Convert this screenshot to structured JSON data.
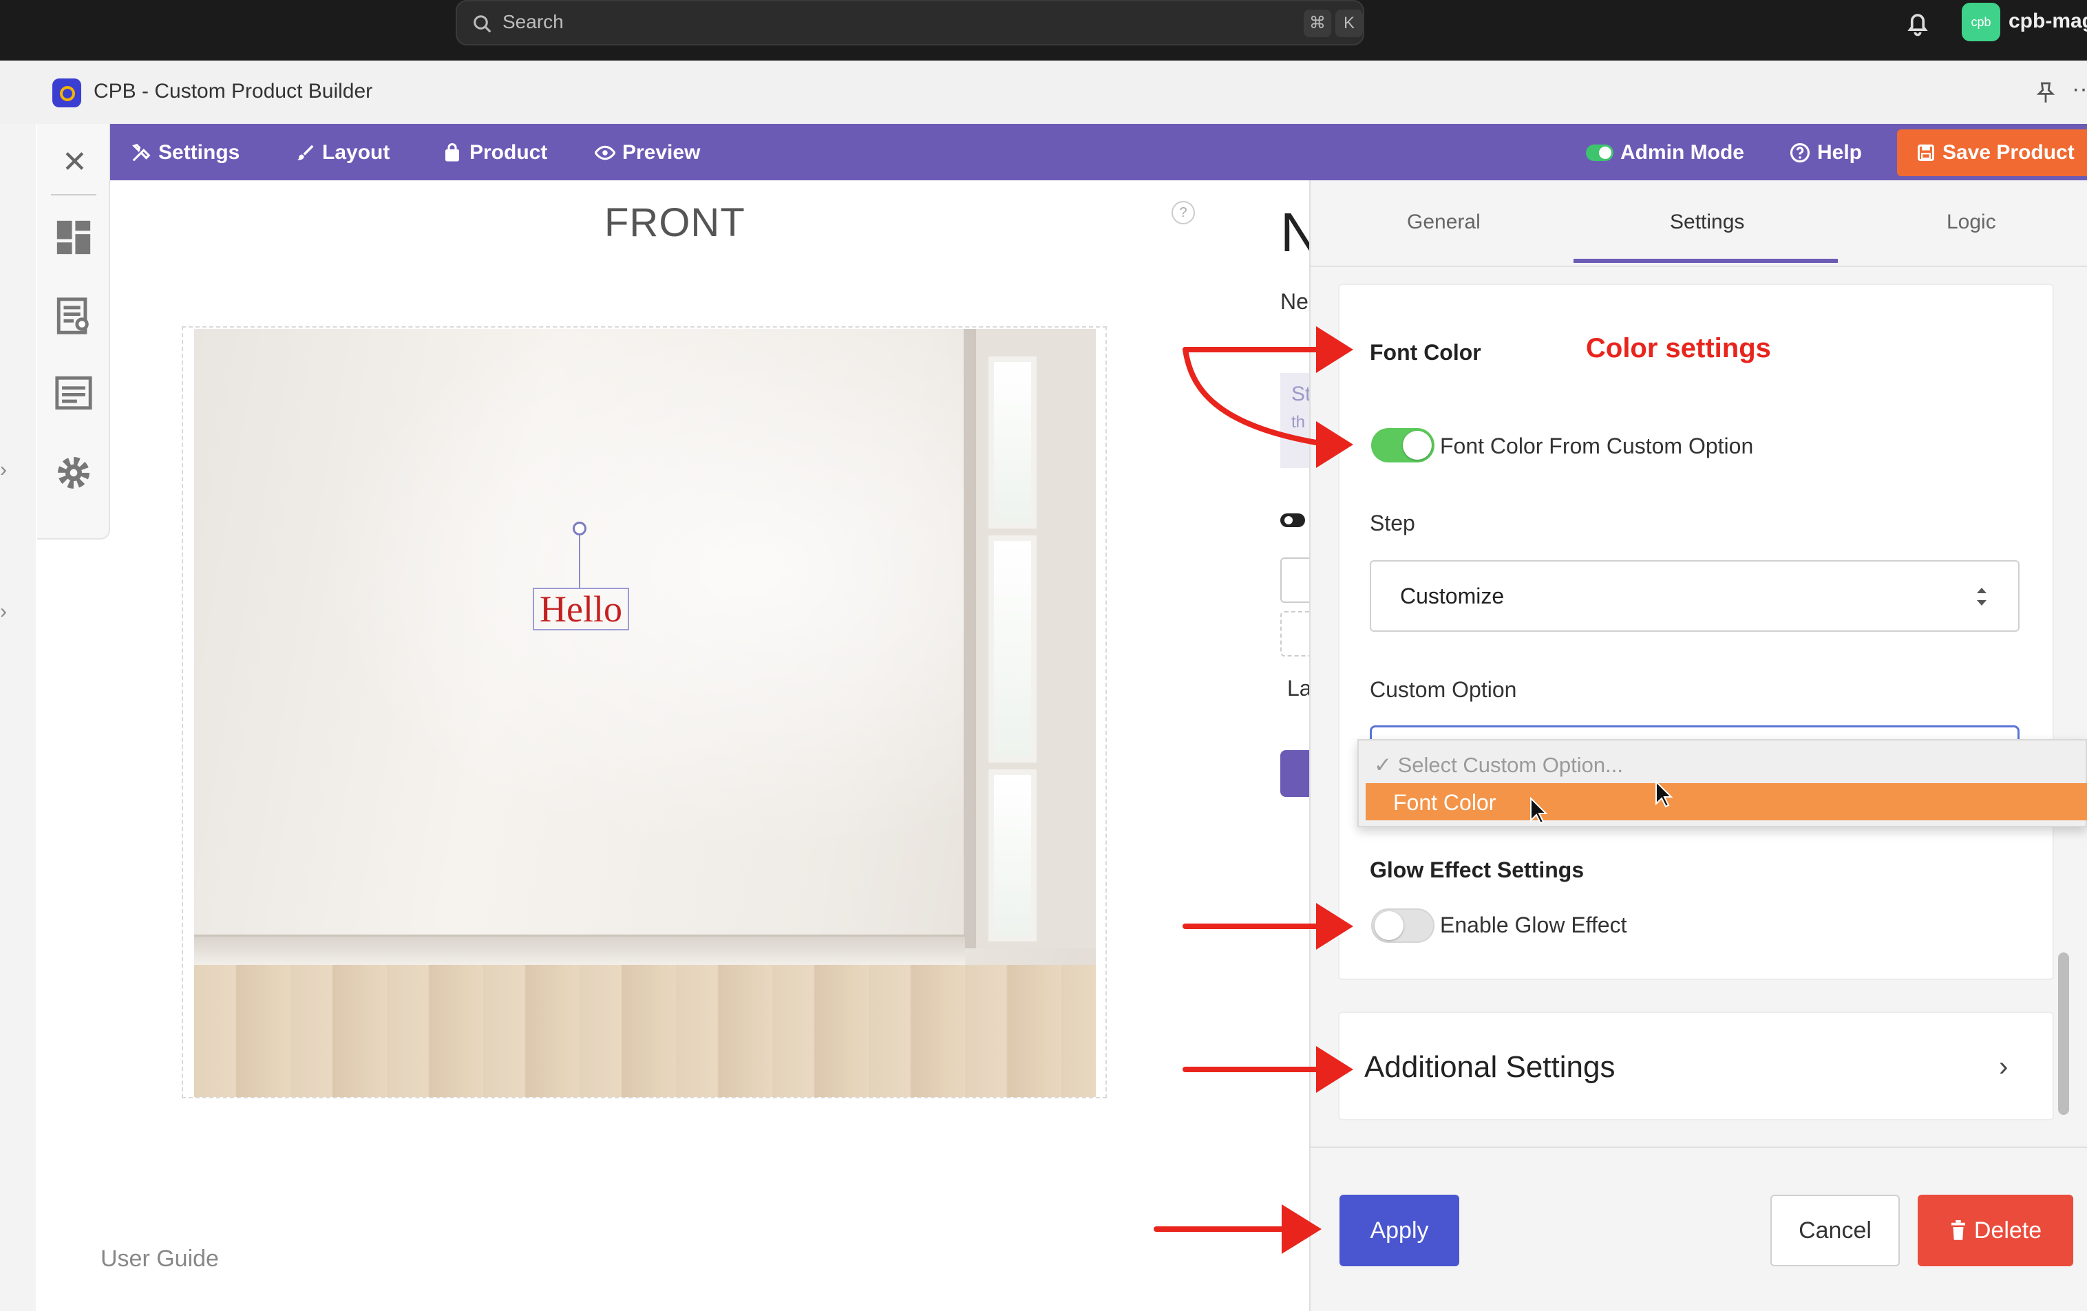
{
  "os_bar": {
    "search_placeholder": "Search",
    "shortcut_keys": [
      "⌘",
      "K"
    ],
    "avatar_text": "cpb",
    "account_name": "cpb-mage"
  },
  "app": {
    "title": "CPB - Custom Product Builder"
  },
  "toolbar": {
    "items": [
      {
        "label": "Settings",
        "icon": "tools-icon"
      },
      {
        "label": "Layout",
        "icon": "brush-icon"
      },
      {
        "label": "Product",
        "icon": "bag-icon"
      },
      {
        "label": "Preview",
        "icon": "eye-icon"
      }
    ],
    "admin_mode_label": "Admin Mode",
    "admin_mode_on": true,
    "help_label": "Help",
    "save_label": "Save Product"
  },
  "canvas": {
    "view_label": "FRONT",
    "help_glyph": "?",
    "text_element": "Hello",
    "text_color": "#c42020",
    "user_guide_label": "User Guide"
  },
  "middle_peek": {
    "heading_fragment": "N",
    "subtitle_fragment": "Ne",
    "hint_line1_fragment": "St",
    "hint_line2_fragment": "th",
    "label_fragment": "La"
  },
  "panel": {
    "tabs": [
      {
        "label": "General",
        "active": false
      },
      {
        "label": "Settings",
        "active": true
      },
      {
        "label": "Logic",
        "active": false
      }
    ],
    "font_color_heading": "Font Color",
    "annotation": "Color settings",
    "font_color_from_custom_option": {
      "label": "Font Color From Custom Option",
      "on": true
    },
    "step_label": "Step",
    "step_value": "Customize",
    "custom_option_label": "Custom Option",
    "custom_option_dropdown": {
      "placeholder": "✓ Select Custom Option...",
      "highlighted_option": "Font Color"
    },
    "glow_heading": "Glow Effect Settings",
    "enable_glow": {
      "label": "Enable Glow Effect",
      "on": false
    },
    "additional_settings_label": "Additional Settings",
    "buttons": {
      "apply": "Apply",
      "cancel": "Cancel",
      "delete": "Delete"
    }
  },
  "colors": {
    "toolbar": "#6b5bb5",
    "save": "#f06a32",
    "toggle_on": "#5cc95c",
    "toggle_off": "#e2e2e2",
    "dropdown_highlight": "#f39448",
    "apply": "#4a56cf",
    "delete": "#ea4b3b",
    "annotation": "#e8241c"
  }
}
